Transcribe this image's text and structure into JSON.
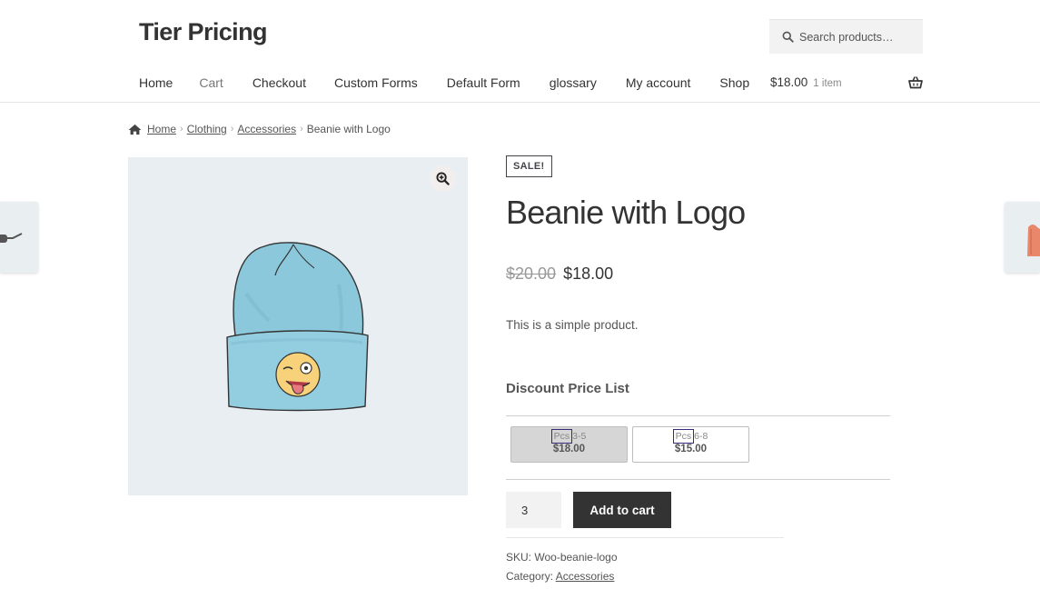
{
  "site": {
    "title": "Tier Pricing"
  },
  "search": {
    "placeholder": "Search products…"
  },
  "nav": {
    "items": [
      "Home",
      "Cart",
      "Checkout",
      "Custom Forms",
      "Default Form",
      "glossary",
      "My account",
      "Shop"
    ]
  },
  "cart": {
    "total": "$18.00",
    "count": "1 item"
  },
  "breadcrumb": {
    "home": "Home",
    "items": [
      "Clothing",
      "Accessories"
    ],
    "current": "Beanie with Logo"
  },
  "product": {
    "badge": "SALE!",
    "title": "Beanie with Logo",
    "old_price": "$20.00",
    "price": "$18.00",
    "description": "This is a simple product.",
    "sku_label": "SKU:",
    "sku": "Woo-beanie-logo",
    "category_label": "Category:",
    "category": "Accessories"
  },
  "discount": {
    "title": "Discount Price List",
    "tiers": [
      {
        "unit": "Pcs",
        "range": "3-5",
        "price": "$18.00",
        "active": true
      },
      {
        "unit": "Pcs",
        "range": "6-8",
        "price": "$15.00",
        "active": false
      }
    ]
  },
  "quantity": {
    "value": "3"
  },
  "buttons": {
    "add_to_cart": "Add to cart"
  },
  "colors": {
    "accent": "#333333",
    "image_bg": "#e8eef2",
    "beanie": "#8cc8dc"
  }
}
